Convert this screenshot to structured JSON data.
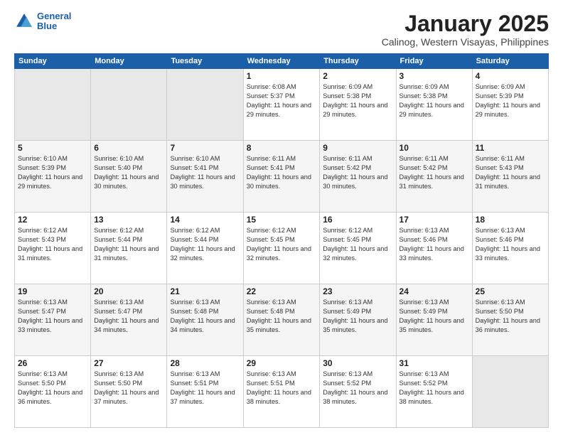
{
  "logo": {
    "line1": "General",
    "line2": "Blue"
  },
  "title": "January 2025",
  "location": "Calinog, Western Visayas, Philippines",
  "weekdays": [
    "Sunday",
    "Monday",
    "Tuesday",
    "Wednesday",
    "Thursday",
    "Friday",
    "Saturday"
  ],
  "weeks": [
    [
      {
        "day": "",
        "empty": true
      },
      {
        "day": "",
        "empty": true
      },
      {
        "day": "",
        "empty": true
      },
      {
        "day": "1",
        "sunrise": "6:08 AM",
        "sunset": "5:37 PM",
        "daylight": "11 hours and 29 minutes."
      },
      {
        "day": "2",
        "sunrise": "6:09 AM",
        "sunset": "5:38 PM",
        "daylight": "11 hours and 29 minutes."
      },
      {
        "day": "3",
        "sunrise": "6:09 AM",
        "sunset": "5:38 PM",
        "daylight": "11 hours and 29 minutes."
      },
      {
        "day": "4",
        "sunrise": "6:09 AM",
        "sunset": "5:39 PM",
        "daylight": "11 hours and 29 minutes."
      }
    ],
    [
      {
        "day": "5",
        "sunrise": "6:10 AM",
        "sunset": "5:39 PM",
        "daylight": "11 hours and 29 minutes."
      },
      {
        "day": "6",
        "sunrise": "6:10 AM",
        "sunset": "5:40 PM",
        "daylight": "11 hours and 30 minutes."
      },
      {
        "day": "7",
        "sunrise": "6:10 AM",
        "sunset": "5:41 PM",
        "daylight": "11 hours and 30 minutes."
      },
      {
        "day": "8",
        "sunrise": "6:11 AM",
        "sunset": "5:41 PM",
        "daylight": "11 hours and 30 minutes."
      },
      {
        "day": "9",
        "sunrise": "6:11 AM",
        "sunset": "5:42 PM",
        "daylight": "11 hours and 30 minutes."
      },
      {
        "day": "10",
        "sunrise": "6:11 AM",
        "sunset": "5:42 PM",
        "daylight": "11 hours and 31 minutes."
      },
      {
        "day": "11",
        "sunrise": "6:11 AM",
        "sunset": "5:43 PM",
        "daylight": "11 hours and 31 minutes."
      }
    ],
    [
      {
        "day": "12",
        "sunrise": "6:12 AM",
        "sunset": "5:43 PM",
        "daylight": "11 hours and 31 minutes."
      },
      {
        "day": "13",
        "sunrise": "6:12 AM",
        "sunset": "5:44 PM",
        "daylight": "11 hours and 31 minutes."
      },
      {
        "day": "14",
        "sunrise": "6:12 AM",
        "sunset": "5:44 PM",
        "daylight": "11 hours and 32 minutes."
      },
      {
        "day": "15",
        "sunrise": "6:12 AM",
        "sunset": "5:45 PM",
        "daylight": "11 hours and 32 minutes."
      },
      {
        "day": "16",
        "sunrise": "6:12 AM",
        "sunset": "5:45 PM",
        "daylight": "11 hours and 32 minutes."
      },
      {
        "day": "17",
        "sunrise": "6:13 AM",
        "sunset": "5:46 PM",
        "daylight": "11 hours and 33 minutes."
      },
      {
        "day": "18",
        "sunrise": "6:13 AM",
        "sunset": "5:46 PM",
        "daylight": "11 hours and 33 minutes."
      }
    ],
    [
      {
        "day": "19",
        "sunrise": "6:13 AM",
        "sunset": "5:47 PM",
        "daylight": "11 hours and 33 minutes."
      },
      {
        "day": "20",
        "sunrise": "6:13 AM",
        "sunset": "5:47 PM",
        "daylight": "11 hours and 34 minutes."
      },
      {
        "day": "21",
        "sunrise": "6:13 AM",
        "sunset": "5:48 PM",
        "daylight": "11 hours and 34 minutes."
      },
      {
        "day": "22",
        "sunrise": "6:13 AM",
        "sunset": "5:48 PM",
        "daylight": "11 hours and 35 minutes."
      },
      {
        "day": "23",
        "sunrise": "6:13 AM",
        "sunset": "5:49 PM",
        "daylight": "11 hours and 35 minutes."
      },
      {
        "day": "24",
        "sunrise": "6:13 AM",
        "sunset": "5:49 PM",
        "daylight": "11 hours and 35 minutes."
      },
      {
        "day": "25",
        "sunrise": "6:13 AM",
        "sunset": "5:50 PM",
        "daylight": "11 hours and 36 minutes."
      }
    ],
    [
      {
        "day": "26",
        "sunrise": "6:13 AM",
        "sunset": "5:50 PM",
        "daylight": "11 hours and 36 minutes."
      },
      {
        "day": "27",
        "sunrise": "6:13 AM",
        "sunset": "5:50 PM",
        "daylight": "11 hours and 37 minutes."
      },
      {
        "day": "28",
        "sunrise": "6:13 AM",
        "sunset": "5:51 PM",
        "daylight": "11 hours and 37 minutes."
      },
      {
        "day": "29",
        "sunrise": "6:13 AM",
        "sunset": "5:51 PM",
        "daylight": "11 hours and 38 minutes."
      },
      {
        "day": "30",
        "sunrise": "6:13 AM",
        "sunset": "5:52 PM",
        "daylight": "11 hours and 38 minutes."
      },
      {
        "day": "31",
        "sunrise": "6:13 AM",
        "sunset": "5:52 PM",
        "daylight": "11 hours and 38 minutes."
      },
      {
        "day": "",
        "empty": true
      }
    ]
  ]
}
